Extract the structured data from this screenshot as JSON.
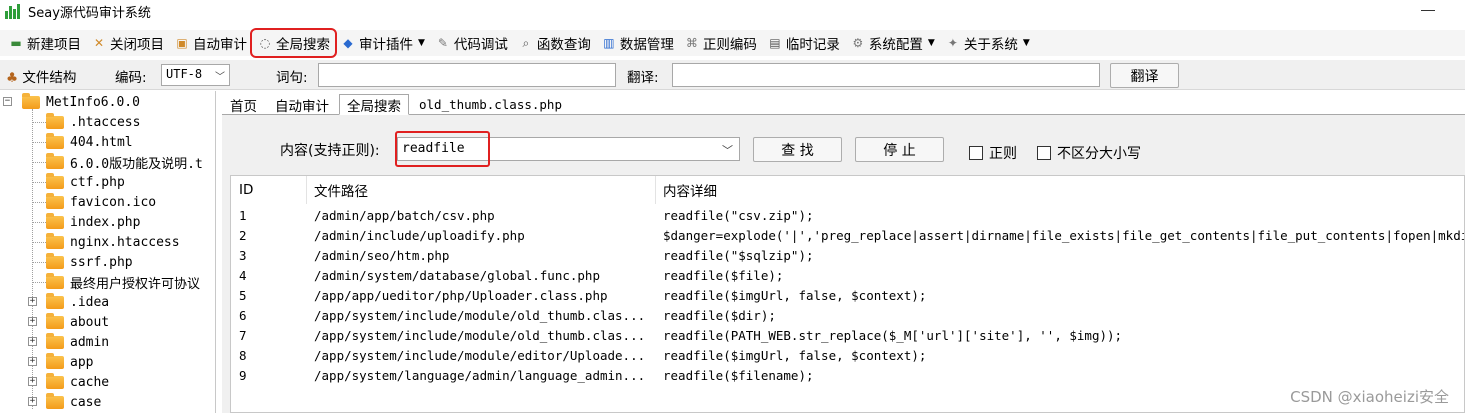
{
  "window": {
    "title": "Seay源代码审计系统"
  },
  "menu": [
    {
      "label": "新建项目",
      "icon": "new-project-icon",
      "color": "#3a8a3a"
    },
    {
      "label": "关闭项目",
      "icon": "close-project-icon",
      "color": "#d08a2a"
    },
    {
      "label": "自动审计",
      "icon": "auto-audit-icon",
      "color": "#d08a2a"
    },
    {
      "label": "全局搜索",
      "icon": "global-search-icon",
      "color": "#555555",
      "highlighted": true
    },
    {
      "label": "审计插件",
      "icon": "audit-plugin-icon",
      "color": "#2a6ad0",
      "dropdown": true
    },
    {
      "label": "代码调试",
      "icon": "code-debug-icon",
      "color": "#777777"
    },
    {
      "label": "函数查询",
      "icon": "function-query-icon",
      "color": "#555555"
    },
    {
      "label": "数据管理",
      "icon": "data-manage-icon",
      "color": "#2a6ad0"
    },
    {
      "label": "正则编码",
      "icon": "regex-encode-icon",
      "color": "#777777"
    },
    {
      "label": "临时记录",
      "icon": "temp-record-icon",
      "color": "#555555"
    },
    {
      "label": "系统配置",
      "icon": "gear-icon",
      "color": "#777777",
      "dropdown": true
    },
    {
      "label": "关于系统",
      "icon": "about-icon",
      "color": "#777777",
      "dropdown": true
    }
  ],
  "toolbar": {
    "file_structure_label": "文件结构",
    "encoding_label": "编码:",
    "encoding_value": "UTF-8",
    "word_label": "词句:",
    "translate_label": "翻译:",
    "translate_button": "翻译"
  },
  "tree": {
    "root": "MetInfo6.0.0",
    "files": [
      ".htaccess",
      "404.html",
      "6.0.0版功能及说明.t",
      "ctf.php",
      "favicon.ico",
      "index.php",
      "nginx.htaccess",
      "ssrf.php",
      "最终用户授权许可协议"
    ],
    "folders": [
      ".idea",
      "about",
      "admin",
      "app",
      "cache",
      "case"
    ]
  },
  "tabs": [
    "首页",
    "自动审计",
    "全局搜索",
    "old_thumb.class.php"
  ],
  "search": {
    "content_label": "内容(支持正则):",
    "query": "readfile",
    "find_button": "查 找",
    "stop_button": "停 止",
    "regex_label": "正则",
    "case_label": "不区分大小写"
  },
  "results": {
    "headers": {
      "id": "ID",
      "path": "文件路径",
      "detail": "内容详细"
    },
    "rows": [
      {
        "id": "1",
        "path": "/admin/app/batch/csv.php",
        "detail": "readfile(\"csv.zip\");"
      },
      {
        "id": "2",
        "path": "/admin/include/uploadify.php",
        "detail": "$danger=explode('|','preg_replace|assert|dirname|file_exists|file_get_contents|file_put_contents|fopen|mkdi"
      },
      {
        "id": "3",
        "path": "/admin/seo/htm.php",
        "detail": "readfile(\"$sqlzip\");"
      },
      {
        "id": "4",
        "path": "/admin/system/database/global.func.php",
        "detail": "readfile($file);"
      },
      {
        "id": "5",
        "path": "/app/app/ueditor/php/Uploader.class.php",
        "detail": "readfile($imgUrl, false, $context);"
      },
      {
        "id": "6",
        "path": "/app/system/include/module/old_thumb.clas...",
        "detail": "readfile($dir);"
      },
      {
        "id": "7",
        "path": "/app/system/include/module/old_thumb.clas...",
        "detail": "readfile(PATH_WEB.str_replace($_M['url']['site'], '', $img));"
      },
      {
        "id": "8",
        "path": "/app/system/include/module/editor/Uploade...",
        "detail": "readfile($imgUrl, false, $context);"
      },
      {
        "id": "9",
        "path": "/app/system/language/admin/language_admin...",
        "detail": "readfile($filename);"
      }
    ]
  },
  "watermark": "CSDN @xiaoheizi安全",
  "colors": {
    "highlight": "#e02020",
    "folder": "#f39b1a"
  }
}
